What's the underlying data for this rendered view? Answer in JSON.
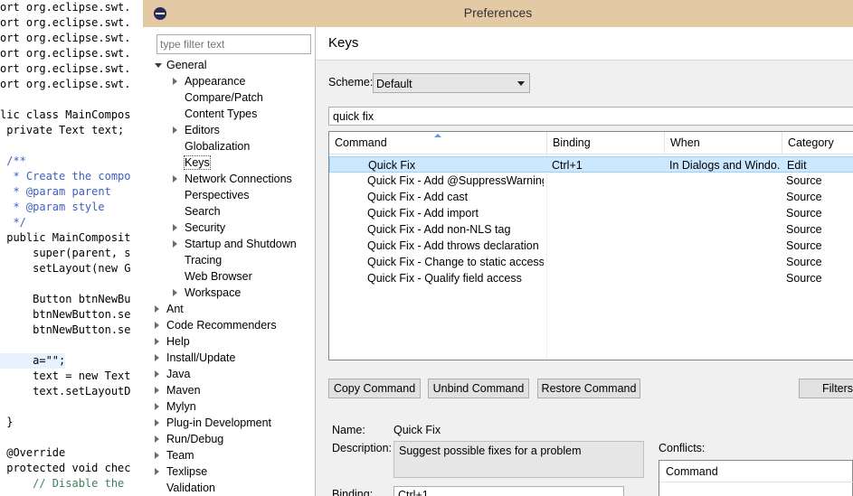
{
  "editor": {
    "lines": [
      "ort org.eclipse.swt.",
      "ort org.eclipse.swt.",
      "ort org.eclipse.swt.",
      "ort org.eclipse.swt.",
      "ort org.eclipse.swt.",
      "ort org.eclipse.swt.",
      "",
      "lic class MainCompos",
      " private Text text;",
      "",
      " /**",
      "  * Create the compo",
      "  * @param parent",
      "  * @param style",
      "  */",
      " public MainComposit",
      "     super(parent, s",
      "     setLayout(new G",
      "",
      "     Button btnNewBu",
      "     btnNewButton.se",
      "     btnNewButton.se",
      "",
      "     a=\"\";",
      "     text = new Text",
      "     text.setLayoutD",
      "",
      " }",
      "",
      " @Override",
      " protected void chec",
      "     // Disable the"
    ]
  },
  "window": {
    "title": "Preferences"
  },
  "tree": {
    "filter_placeholder": "type filter text",
    "items": [
      {
        "label": "General",
        "level": 0,
        "twisty": "open"
      },
      {
        "label": "Appearance",
        "level": 1,
        "twisty": "closed"
      },
      {
        "label": "Compare/Patch",
        "level": 1,
        "twisty": "none"
      },
      {
        "label": "Content Types",
        "level": 1,
        "twisty": "none"
      },
      {
        "label": "Editors",
        "level": 1,
        "twisty": "closed"
      },
      {
        "label": "Globalization",
        "level": 1,
        "twisty": "none"
      },
      {
        "label": "Keys",
        "level": 1,
        "twisty": "none",
        "selected": true
      },
      {
        "label": "Network Connections",
        "level": 1,
        "twisty": "closed"
      },
      {
        "label": "Perspectives",
        "level": 1,
        "twisty": "none"
      },
      {
        "label": "Search",
        "level": 1,
        "twisty": "none"
      },
      {
        "label": "Security",
        "level": 1,
        "twisty": "closed"
      },
      {
        "label": "Startup and Shutdown",
        "level": 1,
        "twisty": "closed"
      },
      {
        "label": "Tracing",
        "level": 1,
        "twisty": "none"
      },
      {
        "label": "Web Browser",
        "level": 1,
        "twisty": "none"
      },
      {
        "label": "Workspace",
        "level": 1,
        "twisty": "closed"
      },
      {
        "label": "Ant",
        "level": 0,
        "twisty": "closed"
      },
      {
        "label": "Code Recommenders",
        "level": 0,
        "twisty": "closed"
      },
      {
        "label": "Help",
        "level": 0,
        "twisty": "closed"
      },
      {
        "label": "Install/Update",
        "level": 0,
        "twisty": "closed"
      },
      {
        "label": "Java",
        "level": 0,
        "twisty": "closed"
      },
      {
        "label": "Maven",
        "level": 0,
        "twisty": "closed"
      },
      {
        "label": "Mylyn",
        "level": 0,
        "twisty": "closed"
      },
      {
        "label": "Plug-in Development",
        "level": 0,
        "twisty": "closed"
      },
      {
        "label": "Run/Debug",
        "level": 0,
        "twisty": "closed"
      },
      {
        "label": "Team",
        "level": 0,
        "twisty": "closed"
      },
      {
        "label": "Texlipse",
        "level": 0,
        "twisty": "closed"
      },
      {
        "label": "Validation",
        "level": 0,
        "twisty": "none"
      }
    ]
  },
  "keys_page": {
    "title": "Keys",
    "scheme_label": "Scheme:",
    "scheme_value": "Default",
    "search_value": "quick fix",
    "columns": [
      "Command",
      "Binding",
      "When",
      "Category"
    ],
    "rows": [
      {
        "command": "Quick Fix",
        "binding": "Ctrl+1",
        "when": "In Dialogs and Windo...",
        "category": "Edit",
        "selected": true
      },
      {
        "command": "Quick Fix - Add @SuppressWarnings",
        "binding": "",
        "when": "",
        "category": "Source"
      },
      {
        "command": "Quick Fix - Add cast",
        "binding": "",
        "when": "",
        "category": "Source"
      },
      {
        "command": "Quick Fix - Add import",
        "binding": "",
        "when": "",
        "category": "Source"
      },
      {
        "command": "Quick Fix - Add non-NLS tag",
        "binding": "",
        "when": "",
        "category": "Source"
      },
      {
        "command": "Quick Fix - Add throws declaration",
        "binding": "",
        "when": "",
        "category": "Source"
      },
      {
        "command": "Quick Fix - Change to static access",
        "binding": "",
        "when": "",
        "category": "Source"
      },
      {
        "command": "Quick Fix - Qualify field access",
        "binding": "",
        "when": "",
        "category": "Source"
      }
    ],
    "buttons": {
      "copy": "Copy Command",
      "unbind": "Unbind Command",
      "restore": "Restore Command",
      "filters": "Filters..."
    },
    "details": {
      "name_label": "Name:",
      "name_value": "Quick Fix",
      "description_label": "Description:",
      "description_value": "Suggest possible fixes for a problem",
      "binding_label": "Binding:",
      "binding_value": "Ctrl+1",
      "conflicts_label": "Conflicts:",
      "conflicts_column": "Command"
    }
  }
}
